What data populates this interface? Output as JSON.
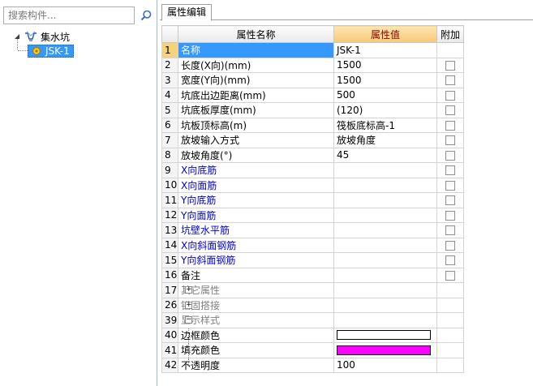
{
  "left": {
    "search": {
      "placeholder": "搜索构件..."
    },
    "tree": {
      "root_label": "集水坑",
      "child_label": "JSK-1"
    }
  },
  "right": {
    "tab_label": "属性编辑",
    "headers": {
      "name": "属性名称",
      "value": "属性值",
      "add": "附加"
    },
    "rows": [
      {
        "num": "1",
        "name": "名称",
        "value": "JSK-1",
        "style": "sel",
        "checkbox": false
      },
      {
        "num": "2",
        "name": "长度(X向)(mm)",
        "value": "1500",
        "style": "",
        "checkbox": true
      },
      {
        "num": "3",
        "name": "宽度(Y向)(mm)",
        "value": "1500",
        "style": "",
        "checkbox": true
      },
      {
        "num": "4",
        "name": "坑底出边距离(mm)",
        "value": "500",
        "style": "",
        "checkbox": true
      },
      {
        "num": "5",
        "name": "坑底板厚度(mm)",
        "value": "(120)",
        "style": "",
        "checkbox": true
      },
      {
        "num": "6",
        "name": "坑板顶标高(m)",
        "value": "筏板底标高-1",
        "style": "",
        "checkbox": true
      },
      {
        "num": "7",
        "name": "放坡输入方式",
        "value": "放坡角度",
        "style": "",
        "checkbox": true
      },
      {
        "num": "8",
        "name": "放坡角度(°)",
        "value": "45",
        "style": "",
        "checkbox": true
      },
      {
        "num": "9",
        "name": "X向底筋",
        "value": "",
        "style": "blue",
        "checkbox": true
      },
      {
        "num": "10",
        "name": "X向面筋",
        "value": "",
        "style": "blue",
        "checkbox": true
      },
      {
        "num": "11",
        "name": "Y向底筋",
        "value": "",
        "style": "blue",
        "checkbox": true
      },
      {
        "num": "12",
        "name": "Y向面筋",
        "value": "",
        "style": "blue",
        "checkbox": true
      },
      {
        "num": "13",
        "name": "坑壁水平筋",
        "value": "",
        "style": "blue",
        "checkbox": true
      },
      {
        "num": "14",
        "name": "X向斜面钢筋",
        "value": "",
        "style": "blue",
        "checkbox": true
      },
      {
        "num": "15",
        "name": "Y向斜面钢筋",
        "value": "",
        "style": "blue",
        "checkbox": true
      },
      {
        "num": "16",
        "name": "备注",
        "value": "",
        "style": "",
        "checkbox": true
      }
    ],
    "groups": [
      {
        "num": "17",
        "name": "其它属性",
        "expander": "+"
      },
      {
        "num": "26",
        "name": "锚固搭接",
        "expander": "+"
      },
      {
        "num": "39",
        "name": "显示样式",
        "expander": "−"
      }
    ],
    "style_rows": [
      {
        "num": "40",
        "name": "边框颜色",
        "swatch": "#ffffff"
      },
      {
        "num": "41",
        "name": "填充颜色",
        "swatch": "#ff00ff"
      },
      {
        "num": "42",
        "name": "不透明度",
        "value": "100"
      }
    ]
  }
}
